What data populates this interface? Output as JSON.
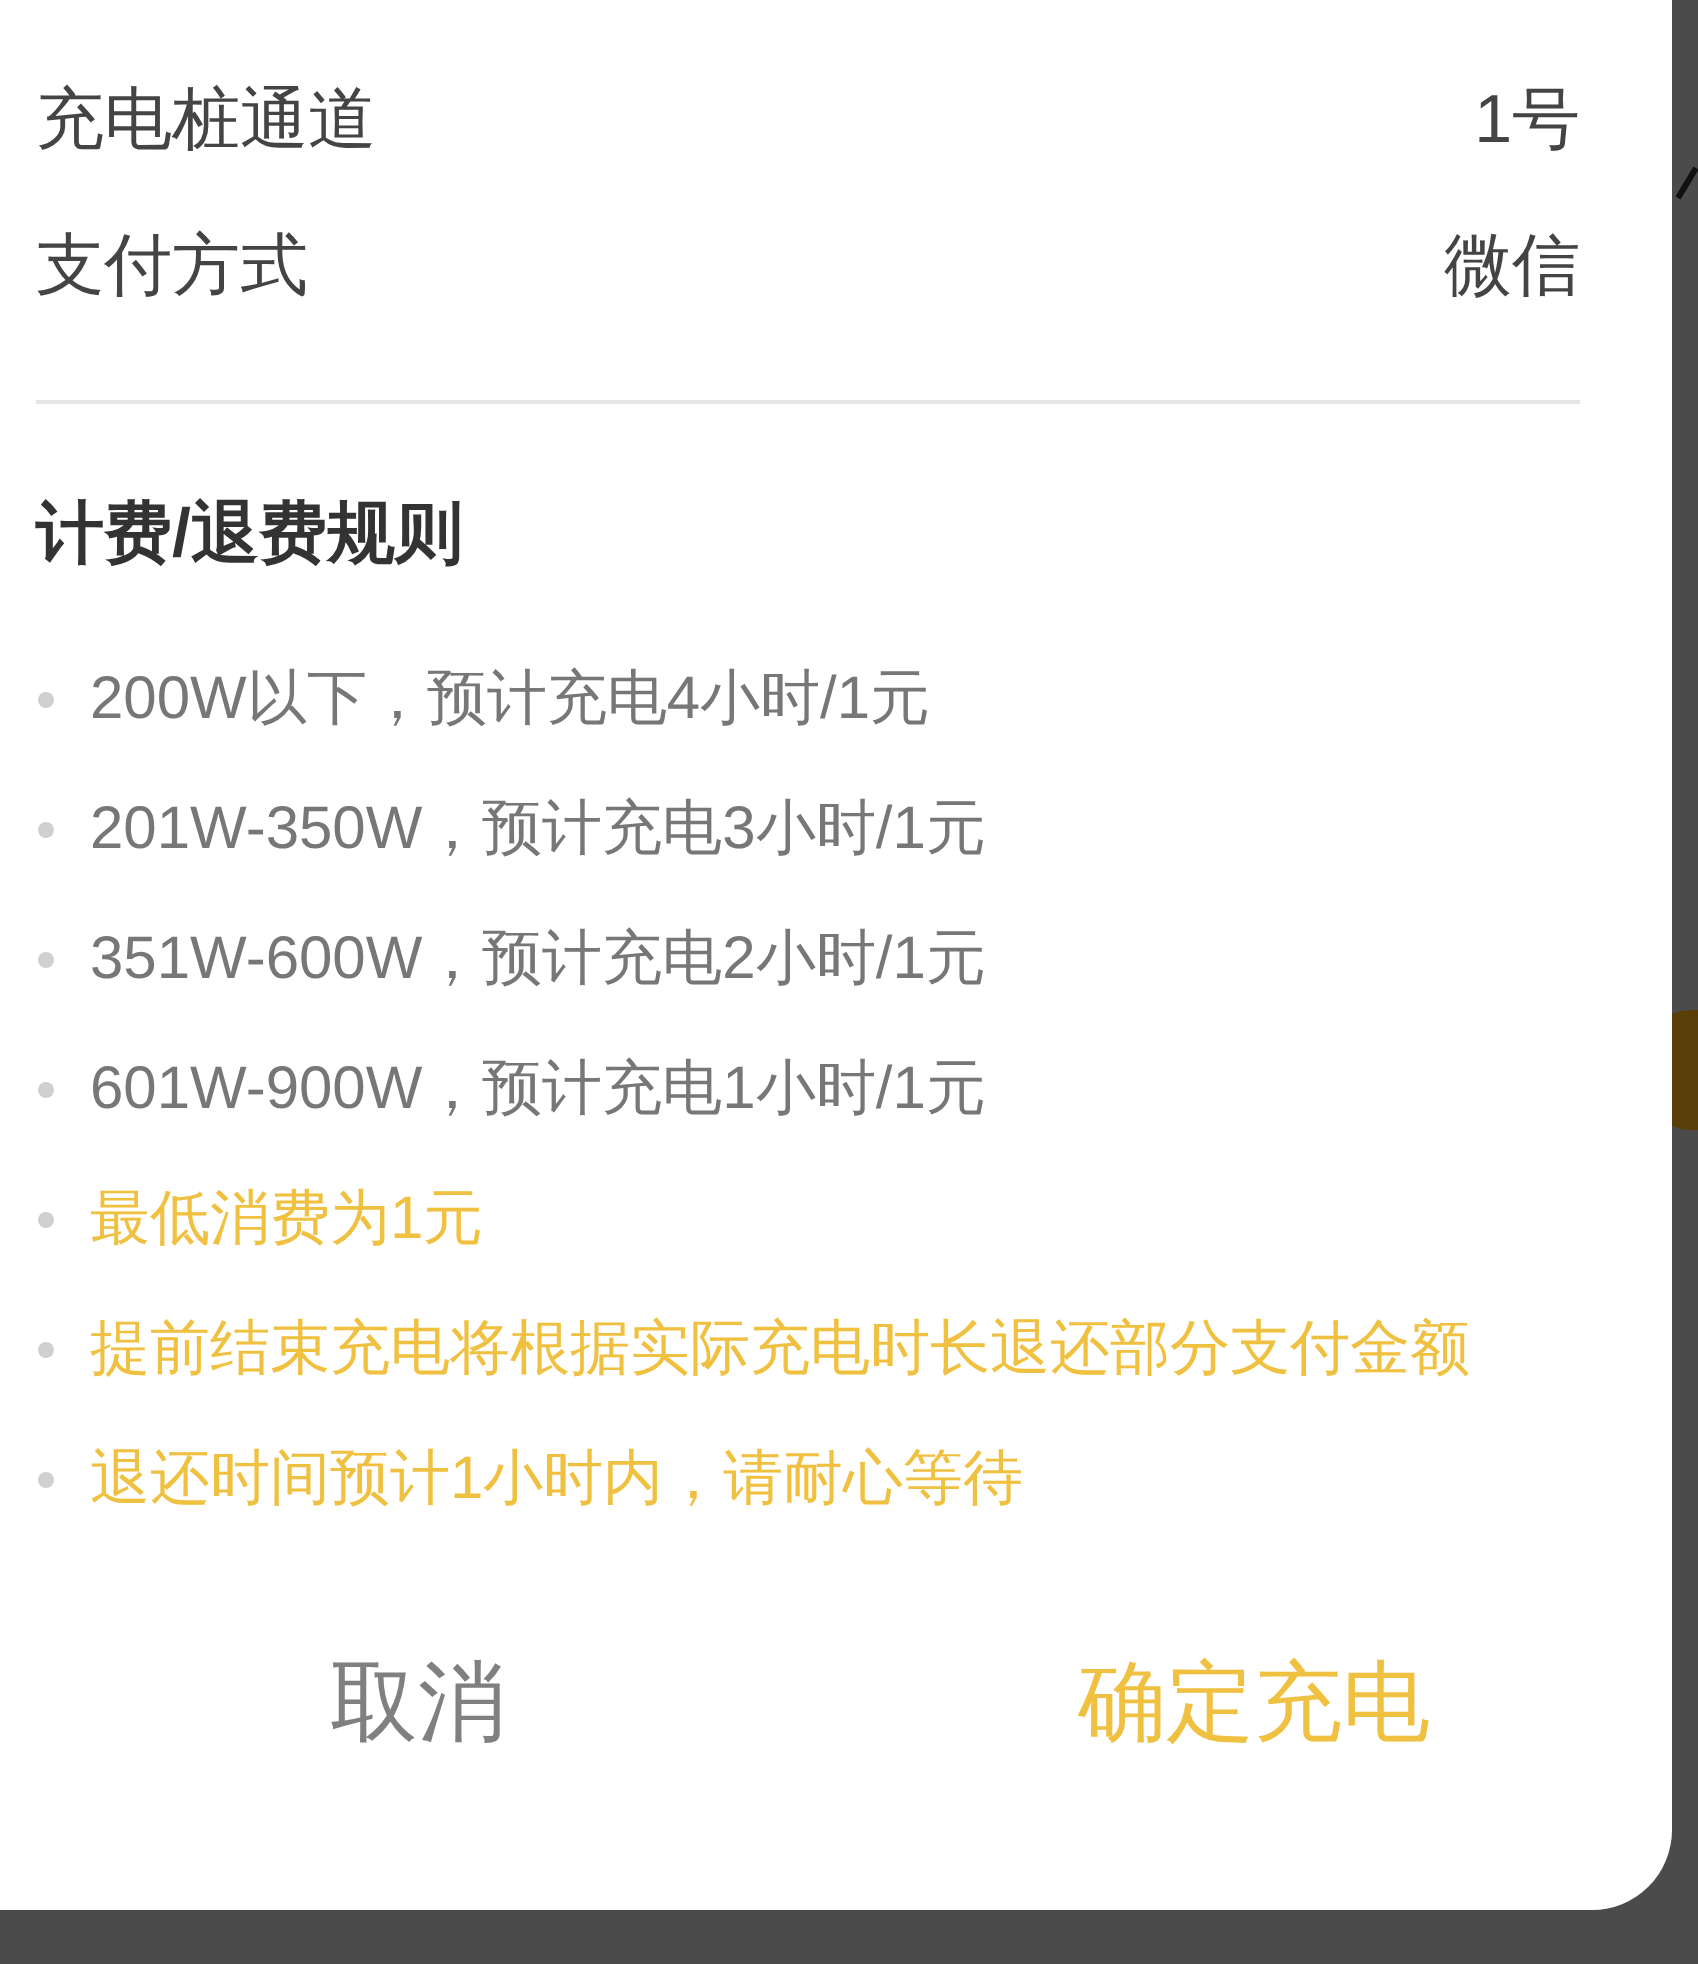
{
  "details": [
    {
      "label": "充电桩通道",
      "value": "1号"
    },
    {
      "label": "支付方式",
      "value": "微信"
    }
  ],
  "rules": {
    "title": "计费/退费规则",
    "items": [
      {
        "kind": "normal",
        "text": "200W以下，预计充电4小时/1元"
      },
      {
        "kind": "normal",
        "text": "201W-350W，预计充电3小时/1元"
      },
      {
        "kind": "normal",
        "text": "351W-600W，预计充电2小时/1元"
      },
      {
        "kind": "normal",
        "text": "601W-900W，预计充电1小时/1元"
      },
      {
        "kind": "highlight",
        "text": "最低消费为1元"
      },
      {
        "kind": "highlight",
        "text": "提前结束充电将根据实际充电时长退还部分支付金额"
      },
      {
        "kind": "highlight",
        "text": "退还时间预计1小时内，请耐心等待"
      }
    ]
  },
  "buttons": [
    {
      "kind": "cancel",
      "label": "取消"
    },
    {
      "kind": "confirm",
      "label": "确定充电"
    }
  ]
}
